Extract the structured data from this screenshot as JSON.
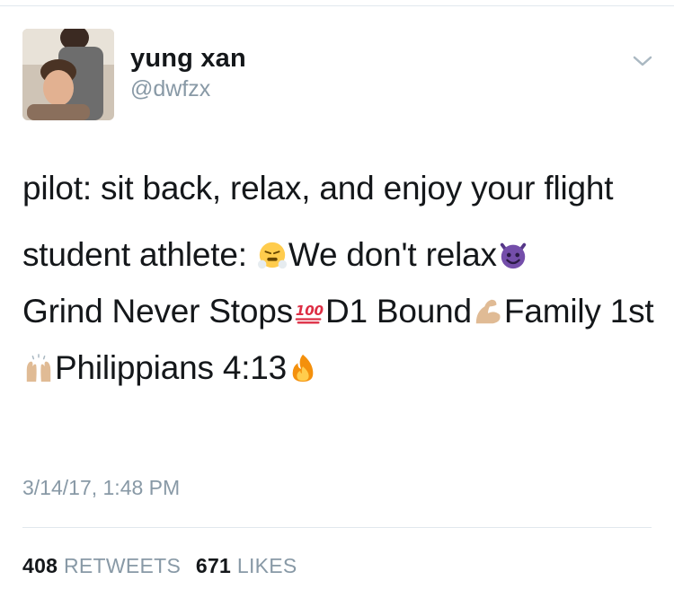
{
  "user": {
    "display_name": "yung xan",
    "handle": "@dwfzx"
  },
  "tweet": {
    "line1": "pilot: sit back, relax, and enjoy your flight",
    "segments": [
      "student athlete: ",
      "We don't relax",
      "Grind Never Stops",
      "D1 Bound",
      "Family 1st",
      "Philippians 4:13"
    ],
    "emojis": [
      "steam-from-nose-face-icon",
      "smiling-devil-icon",
      "hundred-points-icon",
      "flexed-biceps-icon",
      "raised-hands-icon",
      "fire-icon"
    ]
  },
  "timestamp": "3/14/17, 1:48 PM",
  "stats": {
    "retweets_count": "408",
    "retweets_label": "RETWEETS",
    "likes_count": "671",
    "likes_label": "LIKES"
  },
  "colors": {
    "text": "#14171a",
    "secondary": "#8899a6",
    "divider": "#e1e8ed"
  }
}
